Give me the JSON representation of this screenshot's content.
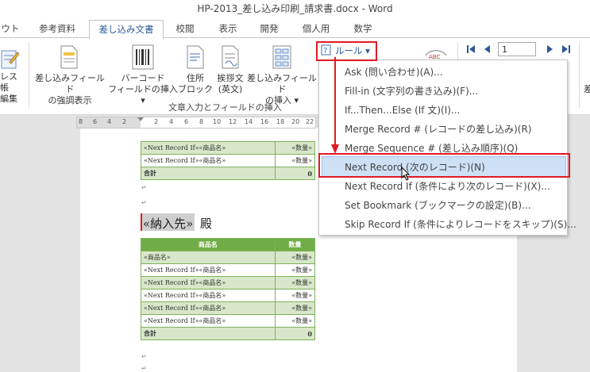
{
  "window": {
    "title": "HP-2013_差し込み印刷_請求書.docx - Word"
  },
  "tabs": [
    "ウト",
    "参考資料",
    "差し込み文書",
    "校閲",
    "表示",
    "開発",
    "個人用",
    "数学"
  ],
  "ribbon": {
    "btn_address": [
      "レス帳",
      "編集"
    ],
    "btn_highlight": [
      "差し込みフィールド",
      "の強調表示"
    ],
    "btn_barcode": [
      "バーコード",
      "フィールドの挿入 ▾"
    ],
    "btn_address_block": [
      "住所",
      "ブロック"
    ],
    "btn_greeting": [
      "挨拶文",
      "(英文)"
    ],
    "btn_insert_field": [
      "差し込みフィールド",
      "の挿入 ▾"
    ],
    "group_label": "文章入力とフィールドの挿入",
    "rules_label": "ルール ▾",
    "abc_label": "ABC",
    "record_number": "1",
    "right_cut": "差"
  },
  "ruler": [
    "8",
    "6",
    "4",
    "2",
    "",
    "2",
    "4",
    "6",
    "8",
    "10",
    "12",
    "14",
    "16",
    "18",
    "20",
    "22"
  ],
  "dropdown": {
    "items": [
      "Ask (問い合わせ)(A)...",
      "Fill-in (文字列の書き込み)(F)...",
      "If...Then...Else (If 文)(I)...",
      "Merge Record # (レコードの差し込み)(R)",
      "Merge Sequence # (差し込み順序)(Q)",
      "Next Record (次のレコード)(N)",
      "Next Record If (条件により次のレコード)(X)...",
      "Set Bookmark (ブックマークの設定)(B)...",
      "Skip Record If (条件によりレコードをスキップ)(S)..."
    ],
    "highlighted_index": 5
  },
  "document": {
    "top_rows": [
      {
        "name": "«Next Record If»«商品名»",
        "qty": "«数量»"
      },
      {
        "name": "«Next Record If»«商品名»",
        "qty": "«数量»"
      }
    ],
    "top_total": {
      "label": "合計",
      "value": "0"
    },
    "addressee_field": "«納入先»",
    "honorific": "殿",
    "headers": [
      "商品名",
      "数量"
    ],
    "rows": [
      {
        "name": "«商品名»",
        "qty": "«数量»"
      },
      {
        "name": "«Next Record If»«商品名»",
        "qty": "«数量»"
      },
      {
        "name": "«Next Record If»«商品名»",
        "qty": "«数量»"
      },
      {
        "name": "«Next Record If»«商品名»",
        "qty": "«数量»"
      },
      {
        "name": "«Next Record If»«商品名»",
        "qty": "«数量»"
      },
      {
        "name": "«Next Record If»«商品名»",
        "qty": "«数量»"
      }
    ],
    "total": {
      "label": "合計",
      "value": "0"
    }
  },
  "colors": {
    "accent": "#2b579a",
    "table_header": "#70ad47",
    "highlight_red": "#e01b24"
  }
}
